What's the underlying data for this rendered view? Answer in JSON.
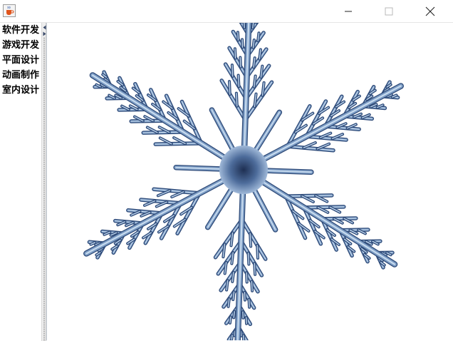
{
  "window": {
    "icon": "java-coffee-cup-icon",
    "controls": [
      "minimize-icon",
      "maximize-icon",
      "close-icon"
    ]
  },
  "sidebar": {
    "items": [
      {
        "label": "软件开发"
      },
      {
        "label": "游戏开发"
      },
      {
        "label": "平面设计"
      },
      {
        "label": "动画制作"
      },
      {
        "label": "室内设计"
      }
    ]
  },
  "split_pane": {
    "collapse_icon": "triangle-left-icon",
    "expand_icon": "triangle-right-icon"
  },
  "content": {
    "image": "snowflake-image"
  },
  "colors": {
    "snowflake_light": "#c9dcef",
    "snowflake_mid": "#7e9ec6",
    "snowflake_dark": "#2e4a78",
    "divider": "#eeeeee"
  }
}
